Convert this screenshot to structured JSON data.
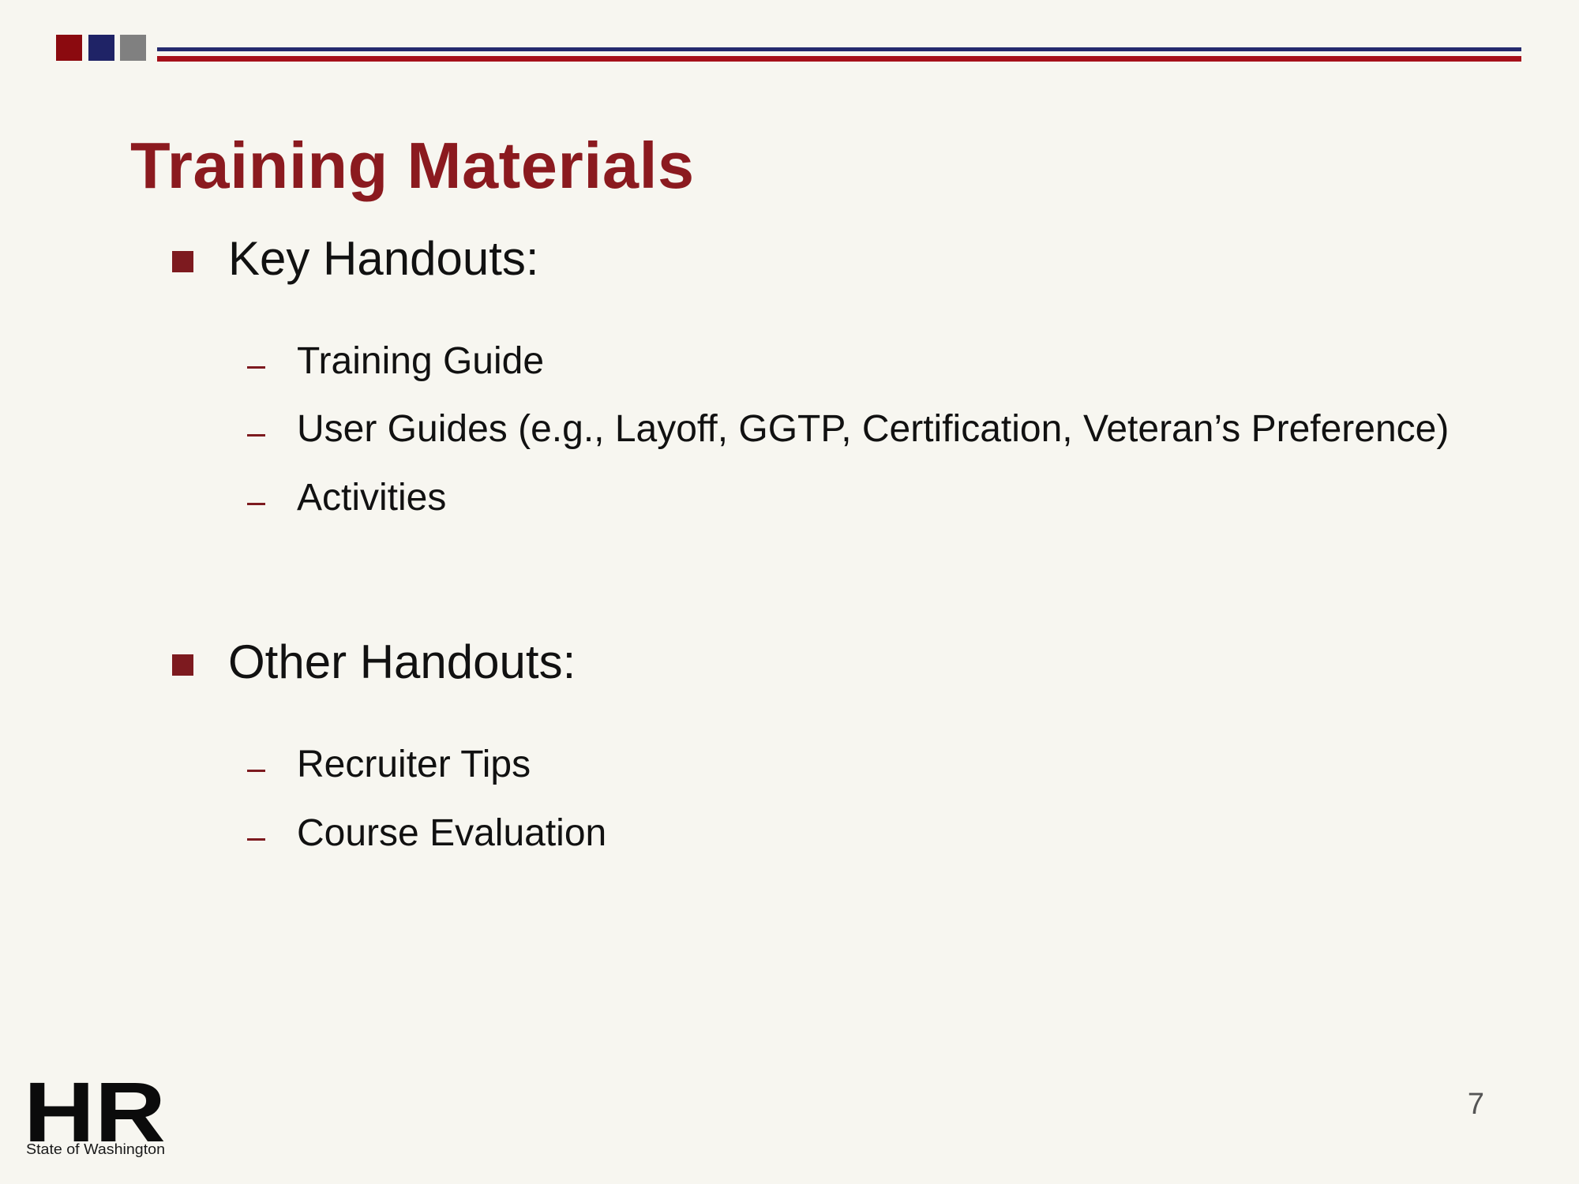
{
  "header": {
    "accent_colors": [
      "#8b0a0f",
      "#1f2366",
      "#808080"
    ]
  },
  "title": "Training Materials",
  "sections": [
    {
      "heading": "Key Handouts:",
      "items": [
        "Training Guide",
        "User Guides (e.g., Layoff, GGTP, Certification, Veteran’s Preference)",
        "Activities"
      ]
    },
    {
      "heading": "Other Handouts:",
      "items": [
        "Recruiter Tips",
        "Course Evaluation"
      ]
    }
  ],
  "logo": {
    "mark": "HR",
    "caption": "State of Washington"
  },
  "page_number": "7",
  "colors": {
    "title": "#8b1a1f",
    "bullet": "#7d1a1f",
    "background": "#f7f6f0"
  }
}
